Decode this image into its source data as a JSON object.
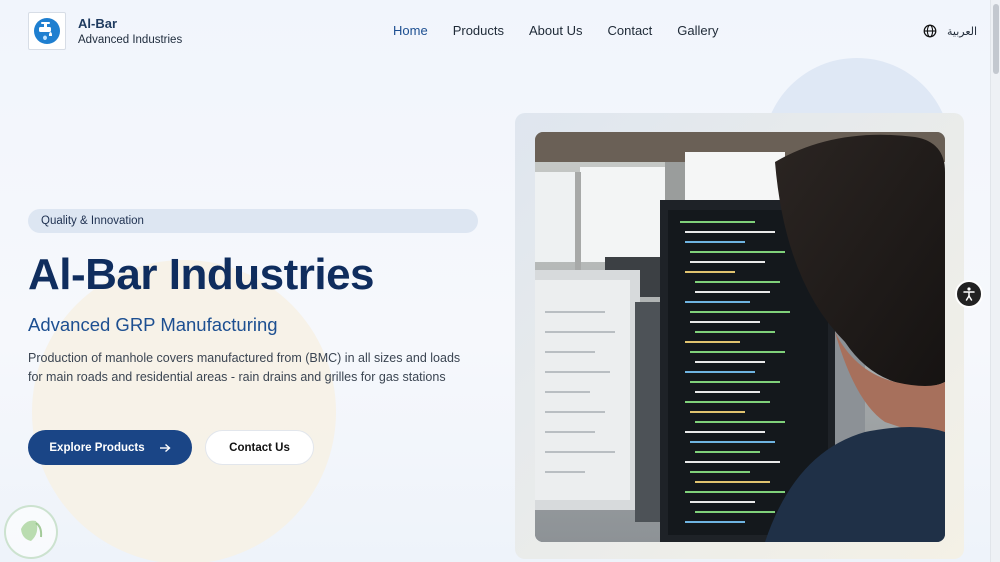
{
  "header": {
    "brand_name": "Al-Bar",
    "brand_sub": "Advanced Industries",
    "logo_icon": "faucet-drop-icon",
    "nav": [
      {
        "label": "Home",
        "active": true
      },
      {
        "label": "Products",
        "active": false
      },
      {
        "label": "About Us",
        "active": false
      },
      {
        "label": "Contact",
        "active": false
      },
      {
        "label": "Gallery",
        "active": false
      }
    ],
    "language_label": "العربية",
    "language_icon": "globe-icon"
  },
  "hero": {
    "badge": "Quality & Innovation",
    "title": "Al-Bar Industries",
    "subtitle": "Advanced GRP Manufacturing",
    "description": "Production of manhole covers manufactured from (BMC) in all sizes and loads for main roads and residential areas - rain drains and grilles for gas stations",
    "primary_button": "Explore Products",
    "primary_button_icon": "arrow-right-icon",
    "secondary_button": "Contact Us",
    "image_icon": "developer-at-monitor-photo"
  },
  "accessibility_icon": "accessibility-icon",
  "colors": {
    "primary": "#1a4586",
    "title": "#0f2d5e",
    "accent": "#1d4f91",
    "badge_bg": "#dde6f2"
  }
}
